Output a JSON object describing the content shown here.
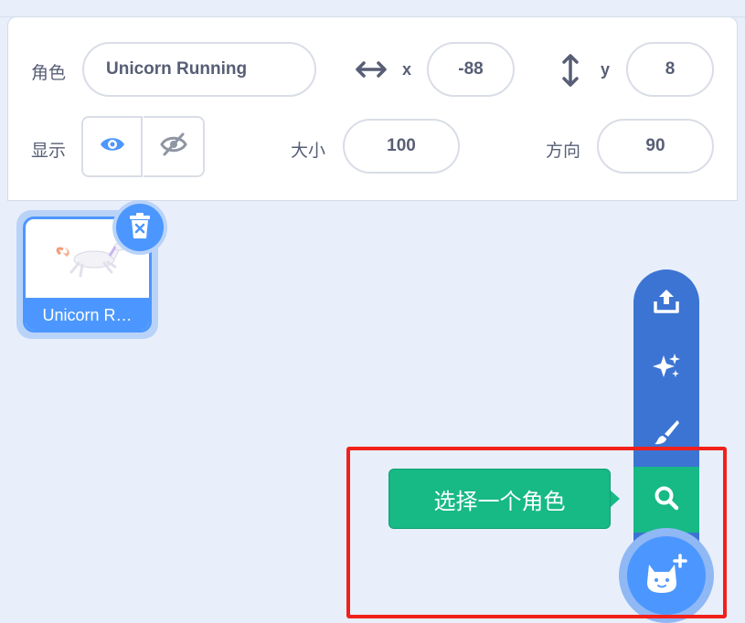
{
  "sprite_info": {
    "sprite_label": "角色",
    "sprite_name": "Unicorn Running",
    "x_label": "x",
    "x_value": "-88",
    "y_label": "y",
    "y_value": "8",
    "show_label": "显示",
    "size_label": "大小",
    "size_value": "100",
    "direction_label": "方向",
    "direction_value": "90"
  },
  "sprites": [
    {
      "caption": "Unicorn R…",
      "selected": true
    }
  ],
  "add_menu": {
    "tooltip": "选择一个角色",
    "items": [
      "upload-icon",
      "surprise-icon",
      "paint-icon",
      "search-icon"
    ],
    "main_icon": "cat-add-icon"
  },
  "colors": {
    "accent": "#4c97ff",
    "menu": "#3c74d3",
    "highlight": "#17b985",
    "annotation": "#f2201b"
  }
}
